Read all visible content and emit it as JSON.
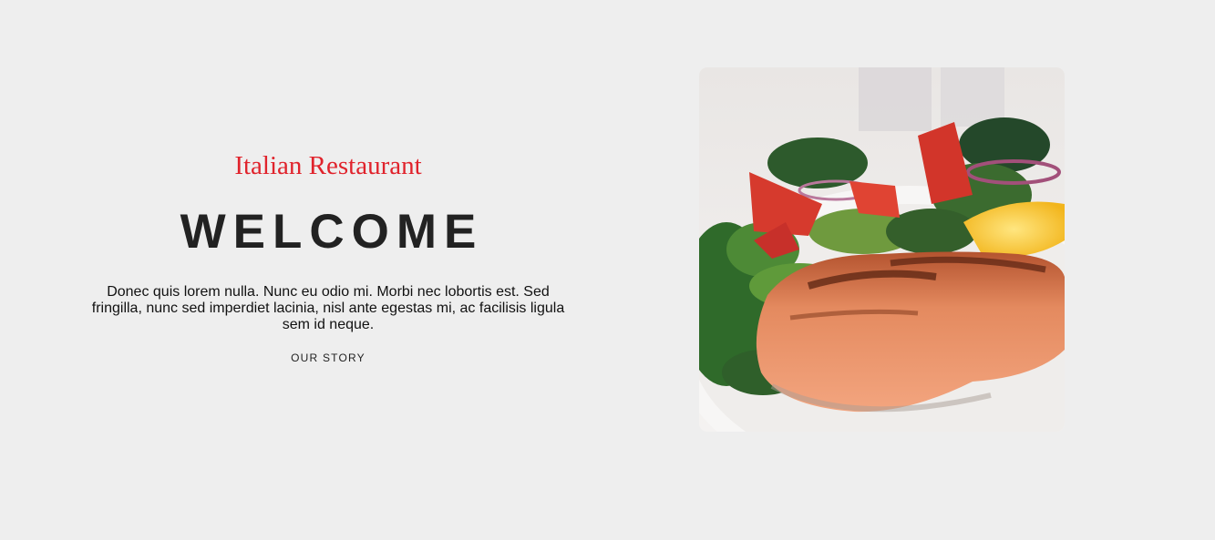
{
  "hero": {
    "subtitle": "Italian Restaurant",
    "title": "WELCOME",
    "description": "Donec quis lorem nulla. Nunc eu odio mi. Morbi nec lobortis est. Sed fringilla, nunc sed imperdiet lacinia, nisl ante egestas mi, ac facilisis ligula sem id neque.",
    "cta_label": "OUR STORY"
  },
  "colors": {
    "background": "#eeeeee",
    "accent": "#e0232c",
    "heading": "#222222"
  },
  "image": {
    "subject": "grilled salmon with salad"
  }
}
